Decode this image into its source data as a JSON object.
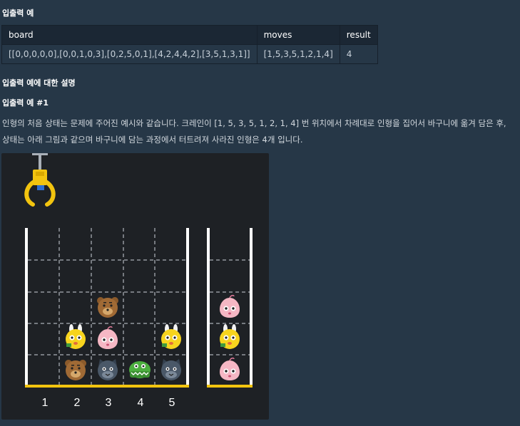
{
  "heading_example": "입출력 예",
  "table": {
    "headers": [
      "board",
      "moves",
      "result"
    ],
    "row": [
      "[[0,0,0,0,0],[0,0,1,0,3],[0,2,5,0,1],[4,2,4,4,2],[3,5,1,3,1]]",
      "[1,5,3,5,1,2,1,4]",
      "4"
    ]
  },
  "heading_explain": "입출력 예에 대한 설명",
  "heading_case": "입출력 예 #1",
  "paragraph": {
    "line1": "인형의 처음 상태는 문제에 주어진 예시와 같습니다. 크레인이 [1, 5, 3, 5, 1, 2, 1, 4] 번 위치에서 차례대로 인형을 집어서 바구니에 옮겨 담은 후,",
    "line2": "상태는 아래 그림과 같으며 바구니에 담는 과정에서 터트려져 사라진 인형은 4개 입니다."
  },
  "figure": {
    "column_labels": [
      "1",
      "2",
      "3",
      "4",
      "5"
    ],
    "accent": "#f2c40f",
    "grid_dolls": [
      {
        "col": 3,
        "row": 3,
        "kind": "bear-icon"
      },
      {
        "col": 2,
        "row": 4,
        "kind": "rabbit-icon"
      },
      {
        "col": 3,
        "row": 4,
        "kind": "peach-icon"
      },
      {
        "col": 5,
        "row": 4,
        "kind": "rabbit-icon"
      },
      {
        "col": 2,
        "row": 5,
        "kind": "bear-icon"
      },
      {
        "col": 3,
        "row": 5,
        "kind": "cat-icon"
      },
      {
        "col": 4,
        "row": 5,
        "kind": "croc-icon"
      },
      {
        "col": 5,
        "row": 5,
        "kind": "cat-icon"
      }
    ],
    "basket_dolls": [
      {
        "slot": 1,
        "kind": "peach-icon"
      },
      {
        "slot": 2,
        "kind": "rabbit-icon"
      },
      {
        "slot": 3,
        "kind": "peach-icon"
      }
    ]
  }
}
